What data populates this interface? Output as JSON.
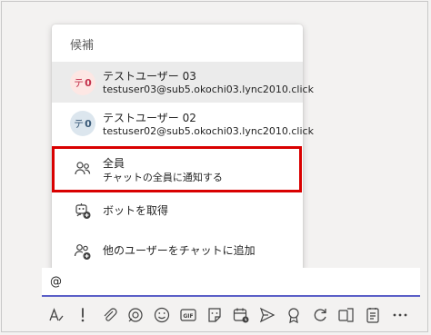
{
  "suggestions": {
    "title": "候補",
    "users": [
      {
        "avatar_kana": "テ",
        "avatar_num": "0",
        "name": "テストユーザー 03",
        "email": "testuser03@sub5.okochi03.lync2010.click",
        "avatar_bg": "#fde7e4",
        "avatar_fg": "#c4314b",
        "selected": true
      },
      {
        "avatar_kana": "テ",
        "avatar_num": "0",
        "name": "テストユーザー 02",
        "email": "testuser02@sub5.okochi03.lync2010.click",
        "avatar_bg": "#dce6ee",
        "avatar_fg": "#3a5a78",
        "selected": false
      }
    ],
    "everyone": {
      "name": "全員",
      "desc": "チャットの全員に通知する",
      "icon": "people-icon"
    },
    "get_bots": {
      "label": "ボットを取得",
      "icon": "bot-add-icon"
    },
    "add_people": {
      "label": "他のユーザーをチャットに追加",
      "icon": "people-add-icon"
    }
  },
  "compose": {
    "text": "@"
  },
  "toolbar": {
    "icons": [
      "format-icon",
      "important-icon",
      "attach-icon",
      "loop-icon",
      "emoji-icon",
      "gif-icon",
      "sticker-icon",
      "schedule-meeting-icon",
      "send-icon",
      "praise-icon",
      "refresh-icon",
      "onenote-icon",
      "forms-icon",
      "more-icon"
    ]
  },
  "colors": {
    "accent": "#5b5fc7",
    "highlight": "#d90000"
  }
}
